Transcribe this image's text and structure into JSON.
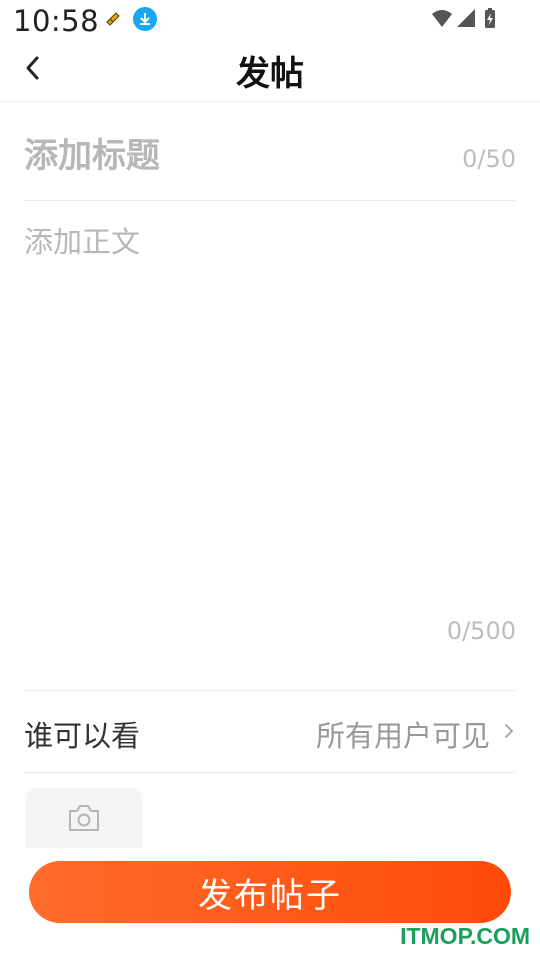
{
  "status_bar": {
    "time": "10:58"
  },
  "header": {
    "title": "发帖"
  },
  "title_field": {
    "placeholder": "添加标题",
    "value": "",
    "counter": "0/50"
  },
  "body_field": {
    "placeholder": "添加正文",
    "value": "",
    "counter": "0/500"
  },
  "visibility": {
    "label": "谁可以看",
    "value": "所有用户可见"
  },
  "publish_button": {
    "label": "发布帖子"
  },
  "watermark": "ITMOP.COM",
  "colors": {
    "accent_start": "#ff6c2a",
    "accent_end": "#ff4a0a",
    "watermark": "#1aa05a"
  },
  "icons": [
    "back-icon",
    "camera-icon",
    "chevron-right-icon",
    "wifi-icon",
    "signal-icon",
    "battery-icon",
    "download-icon"
  ]
}
